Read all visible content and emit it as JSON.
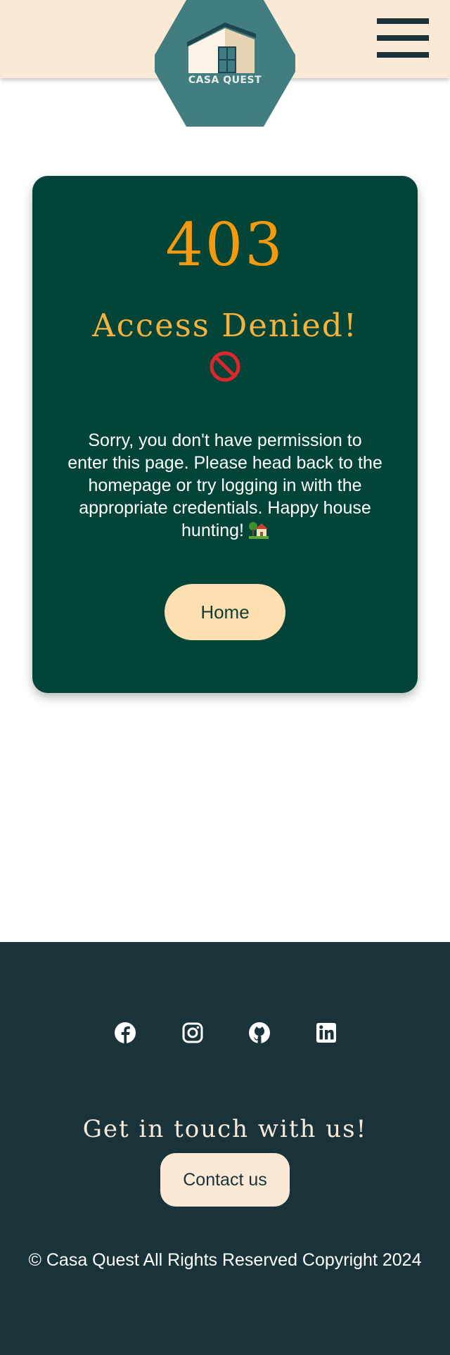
{
  "header": {
    "logo_text": "CASA QUEST",
    "logo_icon": "house-logo-icon",
    "menu_icon": "hamburger-menu-icon"
  },
  "error_card": {
    "code": "403",
    "title": "Access Denied!",
    "title_icon": "prohibited-icon",
    "message": "Sorry, you don't have permission to enter this page. Please head back to the homepage or try logging in with the appropriate credentials. Happy house hunting!",
    "message_icon": "house-with-garden-icon",
    "home_button_label": "Home"
  },
  "footer": {
    "social_links": [
      {
        "icon": "facebook-icon"
      },
      {
        "icon": "instagram-icon"
      },
      {
        "icon": "github-icon"
      },
      {
        "icon": "linkedin-icon"
      }
    ],
    "contact_heading": "Get in touch with us!",
    "contact_button_label": "Contact us",
    "copyright": "© Casa Quest All Rights Reserved Copyright 2024"
  },
  "colors": {
    "header_bg": "#fbe9d7",
    "card_bg": "#024538",
    "accent_orange": "#f59a0e",
    "button_bg": "#fedfb0",
    "footer_bg": "#1a333a",
    "logo_bg": "#427e80"
  }
}
